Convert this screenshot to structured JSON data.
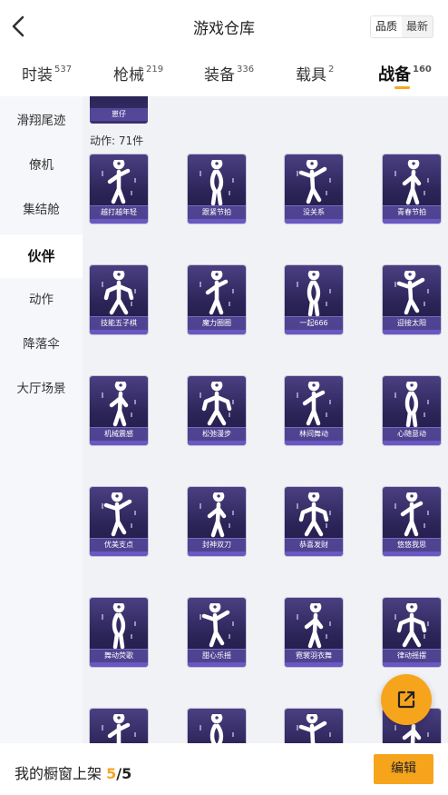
{
  "header": {
    "title": "游戏仓库",
    "sort_options": [
      "品质",
      "最新"
    ],
    "active_sort": "品质"
  },
  "tabs": [
    {
      "label": "时装",
      "count": "537"
    },
    {
      "label": "枪械",
      "count": "219"
    },
    {
      "label": "装备",
      "count": "336"
    },
    {
      "label": "载具",
      "count": "2"
    },
    {
      "label": "战备",
      "count": "160"
    }
  ],
  "active_tab": "战备",
  "sidebar": {
    "items": [
      "滑翔尾迹",
      "僚机",
      "集结舱",
      "伙伴",
      "动作",
      "降落伞",
      "大厅场景"
    ],
    "active": "伙伴"
  },
  "content": {
    "partial_card_label": "崽仔",
    "section_label": "动作: 71件",
    "cards": [
      "越打越年轻",
      "跟紧节拍",
      "没关系",
      "青春节拍",
      "技能五子棋",
      "魔力圈圈",
      "一起666",
      "迎接太阳",
      "机械震感",
      "松弛漫步",
      "林间舞动",
      "心随意动",
      "优美支点",
      "封神双刀",
      "恭喜发财",
      "悠悠我思",
      "舞动荧歌",
      "甜心乐摇",
      "霓裳羽衣舞",
      "律动摇摆",
      "",
      "",
      "",
      ""
    ]
  },
  "bottom": {
    "label": "我的橱窗上架",
    "count": "5",
    "total": "/5",
    "edit_label": "编辑"
  },
  "colors": {
    "accent": "#f7a41d",
    "card_bg": "#2b2457"
  }
}
